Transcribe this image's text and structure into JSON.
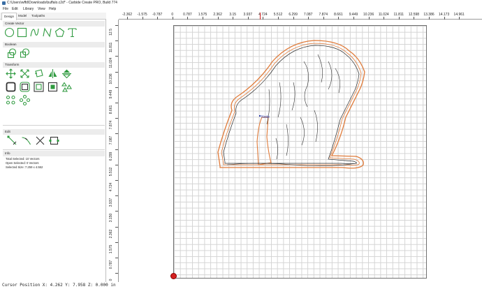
{
  "window": {
    "title": "C:\\Users\\wffd\\Downloads\\buffalo.c2d* - Carbide Create PRO, Build 774"
  },
  "menu": [
    "File",
    "Edit",
    "Library",
    "View",
    "Help"
  ],
  "tabs": [
    "Design",
    "Model",
    "Toolpaths"
  ],
  "sections": {
    "create_vector": "Create Vector",
    "boolean": "Boolean",
    "transform": "Transform",
    "edit": "Edit",
    "info": "Info"
  },
  "info": {
    "total_selected": "Total Selected:  10 Vectors",
    "open_selected": "Open Selected:  0 Vectors",
    "selected_size": "Selected Size:   7.259 x 4.552"
  },
  "ruler": {
    "horizontal": [
      "-2.362",
      "-1.575",
      "-0.787",
      "0",
      "0.787",
      "1.575",
      "2.362",
      "3.15",
      "3.937",
      "4.724",
      "5.512",
      "6.299",
      "7.087",
      "7.874",
      "8.661",
      "9.449",
      "10.236",
      "11.024",
      "11.811",
      "12.598",
      "13.386",
      "14.173",
      "14.961"
    ],
    "vertical": [
      "12.5",
      "11.811",
      "11.024",
      "10.236",
      "9.449",
      "8.661",
      "7.874",
      "7.087",
      "6.299",
      "5.512",
      "4.724",
      "3.937",
      "3.150",
      "2.362",
      "1.575",
      "0.787",
      "0"
    ]
  },
  "canvas": {
    "node_label": "Node"
  },
  "status": {
    "cursor": "Cursor Position X: 4.262 Y: 7.958 Z: 0.000 in"
  },
  "colors": {
    "accent_green": "#2f9a3f",
    "toolpath_orange": "#e07b3a",
    "origin_red": "#d42020"
  }
}
